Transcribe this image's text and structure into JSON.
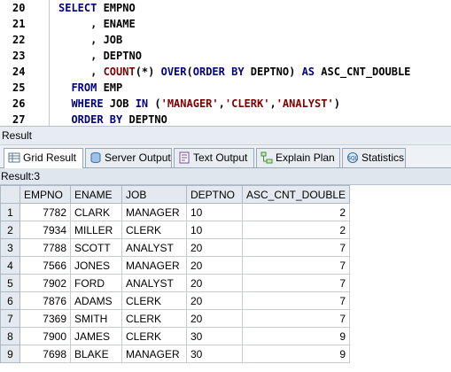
{
  "editor": {
    "lines": [
      {
        "num": "20",
        "tokens": [
          {
            "t": "SELECT ",
            "c": "kw"
          },
          {
            "t": "EMPNO",
            "c": ""
          }
        ]
      },
      {
        "num": "21",
        "tokens": [
          {
            "t": "     , ENAME",
            "c": ""
          }
        ]
      },
      {
        "num": "22",
        "tokens": [
          {
            "t": "     , JOB",
            "c": ""
          }
        ]
      },
      {
        "num": "23",
        "tokens": [
          {
            "t": "     , DEPTNO",
            "c": ""
          }
        ]
      },
      {
        "num": "24",
        "tokens": [
          {
            "t": "     , ",
            "c": ""
          },
          {
            "t": "COUNT",
            "c": "fn"
          },
          {
            "t": "(*) ",
            "c": ""
          },
          {
            "t": "OVER",
            "c": "kw"
          },
          {
            "t": "(",
            "c": ""
          },
          {
            "t": "ORDER BY",
            "c": "kw"
          },
          {
            "t": " DEPTNO) ",
            "c": ""
          },
          {
            "t": "AS",
            "c": "kw"
          },
          {
            "t": " ASC_CNT_DOUBLE",
            "c": ""
          }
        ]
      },
      {
        "num": "25",
        "tokens": [
          {
            "t": "  ",
            "c": ""
          },
          {
            "t": "FROM",
            "c": "kw"
          },
          {
            "t": " EMP",
            "c": ""
          }
        ]
      },
      {
        "num": "26",
        "tokens": [
          {
            "t": "  ",
            "c": ""
          },
          {
            "t": "WHERE",
            "c": "kw"
          },
          {
            "t": " JOB ",
            "c": ""
          },
          {
            "t": "IN",
            "c": "kw"
          },
          {
            "t": " (",
            "c": ""
          },
          {
            "t": "'MANAGER'",
            "c": "str"
          },
          {
            "t": ",",
            "c": ""
          },
          {
            "t": "'CLERK'",
            "c": "str"
          },
          {
            "t": ",",
            "c": ""
          },
          {
            "t": "'ANALYST'",
            "c": "str"
          },
          {
            "t": ")",
            "c": ""
          }
        ]
      },
      {
        "num": "27",
        "tokens": [
          {
            "t": "  ",
            "c": ""
          },
          {
            "t": "ORDER BY",
            "c": "kw"
          },
          {
            "t": " DEPTNO",
            "c": ""
          }
        ]
      }
    ]
  },
  "result": {
    "title": "Result",
    "tabs": [
      {
        "label": "Grid Result",
        "icon": "grid-icon",
        "active": true
      },
      {
        "label": "Server Output",
        "icon": "server-output-icon",
        "active": false
      },
      {
        "label": "Text Output",
        "icon": "text-output-icon",
        "active": false
      },
      {
        "label": "Explain Plan",
        "icon": "explain-plan-icon",
        "active": false
      },
      {
        "label": "Statistics",
        "icon": "statistics-icon",
        "active": false
      }
    ],
    "status": "Result:3"
  },
  "grid": {
    "columns": [
      "EMPNO",
      "ENAME",
      "JOB",
      "DEPTNO",
      "ASC_CNT_DOUBLE"
    ],
    "rows": [
      {
        "n": "1",
        "cells": [
          "7782",
          "CLARK",
          "MANAGER",
          "10",
          "2"
        ]
      },
      {
        "n": "2",
        "cells": [
          "7934",
          "MILLER",
          "CLERK",
          "10",
          "2"
        ]
      },
      {
        "n": "3",
        "cells": [
          "7788",
          "SCOTT",
          "ANALYST",
          "20",
          "7"
        ]
      },
      {
        "n": "4",
        "cells": [
          "7566",
          "JONES",
          "MANAGER",
          "20",
          "7"
        ]
      },
      {
        "n": "5",
        "cells": [
          "7902",
          "FORD",
          "ANALYST",
          "20",
          "7"
        ]
      },
      {
        "n": "6",
        "cells": [
          "7876",
          "ADAMS",
          "CLERK",
          "20",
          "7"
        ]
      },
      {
        "n": "7",
        "cells": [
          "7369",
          "SMITH",
          "CLERK",
          "20",
          "7"
        ]
      },
      {
        "n": "8",
        "cells": [
          "7900",
          "JAMES",
          "CLERK",
          "30",
          "9"
        ]
      },
      {
        "n": "9",
        "cells": [
          "7698",
          "BLAKE",
          "MANAGER",
          "30",
          "9"
        ]
      }
    ]
  },
  "colors": {
    "keyword": "#000080",
    "function": "#800000",
    "string": "#800000",
    "header_bg": "#e3e9ef",
    "panel_bg": "#e6ecf2"
  }
}
